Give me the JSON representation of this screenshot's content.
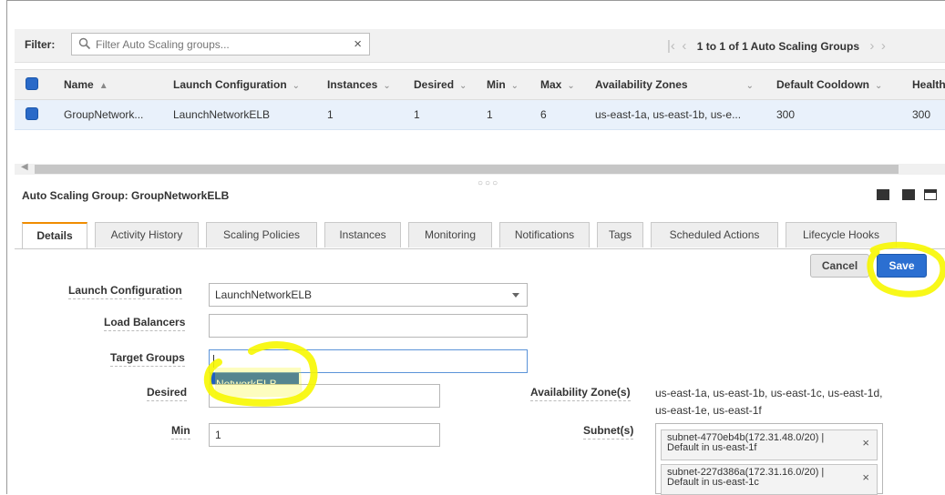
{
  "filter": {
    "label": "Filter:",
    "placeholder": "Filter Auto Scaling groups...",
    "clear_icon": "×",
    "pager_text": "1 to 1 of 1 Auto Scaling Groups"
  },
  "table": {
    "columns": [
      "Name",
      "Launch Configuration",
      "Instances",
      "Desired",
      "Min",
      "Max",
      "Availability Zones",
      "Default Cooldown",
      "Health"
    ],
    "row": {
      "name": "GroupNetwork...",
      "launch_configuration": "LaunchNetworkELB",
      "instances": "1",
      "desired": "1",
      "min": "1",
      "max": "6",
      "availability_zones": "us-east-1a, us-east-1b, us-e...",
      "default_cooldown": "300",
      "health": "300"
    }
  },
  "detail": {
    "title": "Auto Scaling Group: GroupNetworkELB",
    "tabs": [
      "Details",
      "Activity History",
      "Scaling Policies",
      "Instances",
      "Monitoring",
      "Notifications",
      "Tags",
      "Scheduled Actions",
      "Lifecycle Hooks"
    ],
    "active_tab": "Details",
    "cancel_label": "Cancel",
    "save_label": "Save"
  },
  "form": {
    "launch_configuration_label": "Launch Configuration",
    "launch_configuration_value": "LaunchNetworkELB",
    "load_balancers_label": "Load Balancers",
    "load_balancers_value": "",
    "target_groups_label": "Target Groups",
    "target_groups_value": "",
    "target_groups_suggestion": "NetworkELB",
    "desired_label": "Desired",
    "desired_value": "",
    "min_label": "Min",
    "min_value": "1",
    "az_label": "Availability Zone(s)",
    "az_value": "us-east-1a, us-east-1b, us-east-1c, us-east-1d, us-east-1e, us-east-1f",
    "subnet_label": "Subnet(s)",
    "subnets": [
      {
        "line1": "subnet-4770eb4b(172.31.48.0/20) |",
        "line2": "Default in us-east-1f"
      },
      {
        "line1": "subnet-227d386a(172.31.16.0/20) |",
        "line2": "Default in us-east-1c"
      }
    ]
  },
  "colors": {
    "highlight": "#f7f700",
    "primary_button": "#2b6fd1",
    "active_tab_accent": "#f08c00",
    "selected_row": "#e9f1fb"
  }
}
